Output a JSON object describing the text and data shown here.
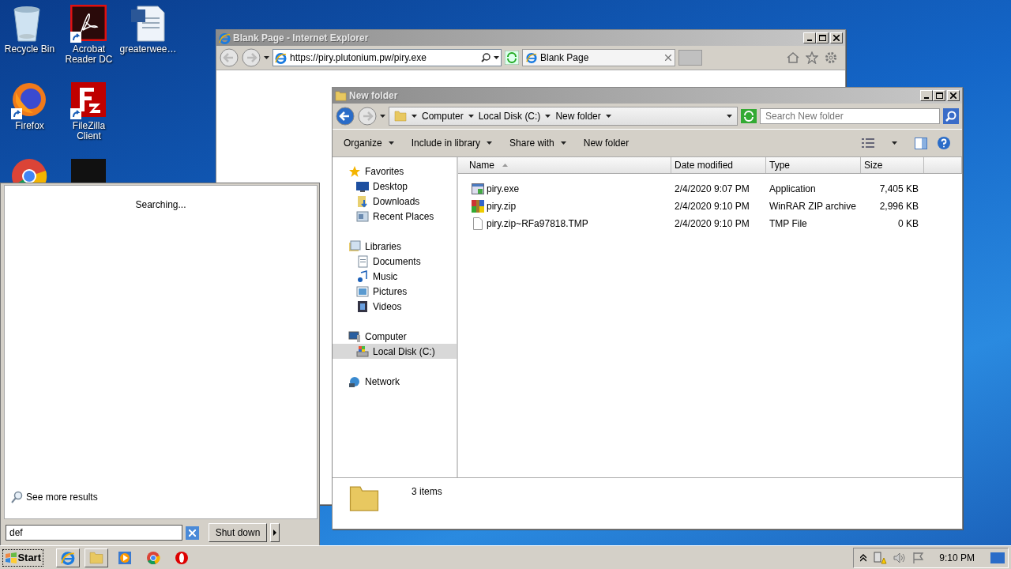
{
  "desktop_icons": [
    {
      "kind": "recycle",
      "label": "Recycle Bin",
      "shortcut": false
    },
    {
      "kind": "firefox",
      "label": "Firefox",
      "shortcut": true
    },
    {
      "kind": "chrome"
    },
    {
      "kind": "acrobat",
      "label": "Acrobat Reader DC",
      "shortcut": true
    },
    {
      "kind": "filezilla",
      "label": "FileZilla Client",
      "shortcut": true
    },
    {
      "kind": "dark"
    },
    {
      "kind": "word",
      "label": "greaterwee…",
      "shortcut": false
    }
  ],
  "browser": {
    "title": "Blank Page - Internet Explorer",
    "address": "https://piry.plutonium.pw/piry.exe",
    "tabs": [
      {
        "label": "Blank Page",
        "selected": true
      }
    ]
  },
  "explorer": {
    "title": "New folder",
    "breadcrumb": [
      "Computer",
      "Local Disk (C:)",
      "New folder"
    ],
    "search_placeholder": "Search New folder",
    "toolbar": [
      {
        "label": "Organize",
        "menu": true
      },
      {
        "label": "Include in library",
        "menu": true
      },
      {
        "label": "Share with",
        "menu": true
      },
      {
        "label": "New folder",
        "menu": false
      }
    ],
    "nav": [
      {
        "label": "Favorites",
        "kind": "star",
        "selected": false,
        "children": [
          {
            "label": "Desktop",
            "kind": "desktop",
            "selected": false
          },
          {
            "label": "Downloads",
            "kind": "downloads",
            "selected": false
          },
          {
            "label": "Recent Places",
            "kind": "recent",
            "selected": false
          }
        ]
      },
      {
        "label": "Libraries",
        "kind": "library",
        "selected": false,
        "children": [
          {
            "label": "Documents",
            "kind": "document",
            "selected": false
          },
          {
            "label": "Music",
            "kind": "music",
            "selected": false
          },
          {
            "label": "Pictures",
            "kind": "pictures",
            "selected": false
          },
          {
            "label": "Videos",
            "kind": "videos",
            "selected": false
          }
        ]
      },
      {
        "label": "Computer",
        "kind": "computer",
        "selected": false,
        "children": [
          {
            "label": "Local Disk (C:)",
            "kind": "disk",
            "selected": true
          }
        ]
      },
      {
        "label": "Network",
        "kind": "network",
        "selected": false
      }
    ],
    "columns": [
      "Name",
      "Date modified",
      "Type",
      "Size"
    ],
    "rows": [
      {
        "kind": "exe",
        "name": "piry.exe",
        "date": "2/4/2020 9:07 PM",
        "type": "Application",
        "size": "7,405 KB"
      },
      {
        "kind": "zip",
        "name": "piry.zip",
        "date": "2/4/2020 9:10 PM",
        "type": "WinRAR ZIP archive",
        "size": "2,996 KB"
      },
      {
        "kind": "file",
        "name": "piry.zip~RFa97818.TMP",
        "date": "2/4/2020 9:10 PM",
        "type": "TMP File",
        "size": "0 KB"
      }
    ],
    "status": "3 items"
  },
  "start_menu": {
    "status": "Searching...",
    "more_link": "See more results",
    "search_value": "def",
    "shutdown": "Shut down"
  },
  "taskbar": {
    "start": "Start",
    "apps": [
      {
        "kind": "ie",
        "pinned_open": true
      },
      {
        "kind": "explorer",
        "pinned_open": true
      },
      {
        "kind": "media",
        "pinned_open": false
      },
      {
        "kind": "chrome",
        "pinned_open": false
      },
      {
        "kind": "opera",
        "pinned_open": false
      }
    ],
    "clock": "9:10 PM"
  }
}
